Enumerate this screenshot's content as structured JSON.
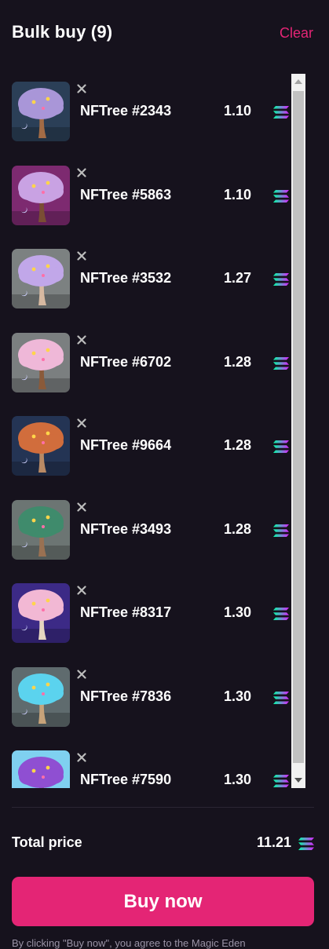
{
  "header": {
    "title": "Bulk buy (9)",
    "clear_label": "Clear"
  },
  "items": [
    {
      "name": "NFTree #2343",
      "price": "1.10",
      "bg": "#2b3f57",
      "foliage": "#a996d8",
      "trunk": "#a26b45"
    },
    {
      "name": "NFTree #5863",
      "price": "1.10",
      "bg": "#7d2a70",
      "foliage": "#c9a2e3",
      "trunk": "#7a4d34"
    },
    {
      "name": "NFTree #3532",
      "price": "1.27",
      "bg": "#7c8181",
      "foliage": "#c1a7e9",
      "trunk": "#d7b9a1"
    },
    {
      "name": "NFTree #6702",
      "price": "1.28",
      "bg": "#7b7f80",
      "foliage": "#efb8d8",
      "trunk": "#8a5a3a"
    },
    {
      "name": "NFTree #9664",
      "price": "1.28",
      "bg": "#243454",
      "foliage": "#d16d3c",
      "trunk": "#b98a64"
    },
    {
      "name": "NFTree #3493",
      "price": "1.28",
      "bg": "#6c7573",
      "foliage": "#3f8b6c",
      "trunk": "#9a7152"
    },
    {
      "name": "NFTree #8317",
      "price": "1.30",
      "bg": "#3c2a86",
      "foliage": "#f2b8d4",
      "trunk": "#e5d6c0"
    },
    {
      "name": "NFTree #7836",
      "price": "1.30",
      "bg": "#5f6b6e",
      "foliage": "#5bd3ee",
      "trunk": "#c7a37a"
    },
    {
      "name": "NFTree #7590",
      "price": "1.30",
      "bg": "#7fd0f0",
      "foliage": "#8f4fd2",
      "trunk": "#6c4b35"
    }
  ],
  "total": {
    "label": "Total price",
    "value": "11.21"
  },
  "buy_label": "Buy now",
  "footer_note": "By clicking \"Buy now\", you agree to the Magic Eden"
}
